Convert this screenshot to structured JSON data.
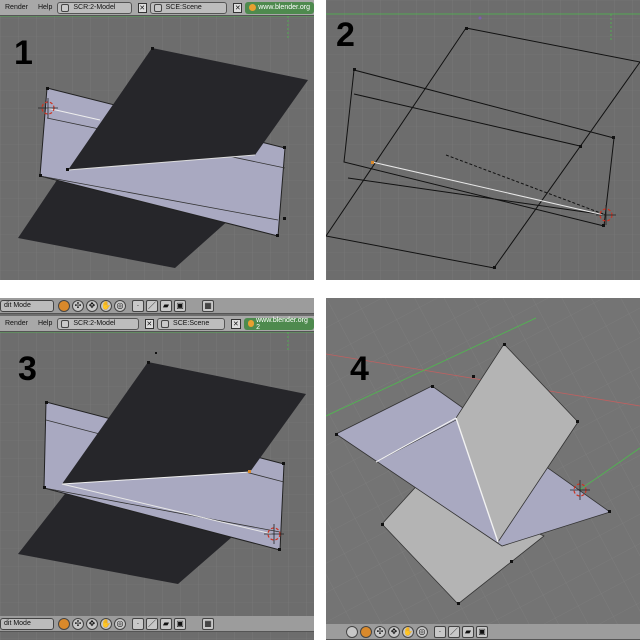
{
  "panels": [
    {
      "number": "1"
    },
    {
      "number": "2"
    },
    {
      "number": "3"
    },
    {
      "number": "4"
    }
  ],
  "header_top": {
    "menu": [
      "Render",
      "Help"
    ],
    "screen_label": "SCR:2-Model",
    "scene_label": "SCE:Scene",
    "url": "www.blender.org"
  },
  "header_p3": {
    "menu": [
      "Render",
      "Help"
    ],
    "screen_label": "SCR:2-Model",
    "scene_label": "SCE:Scene",
    "url": "www.blender.org 2"
  },
  "toolbar_p3_top": {
    "mode": "dit Mode"
  },
  "toolbar_p3_bottom": {
    "mode": "dit Mode"
  },
  "colors": {
    "viewport_bg": "#6d6d6d",
    "face_light": "#a9a9c1",
    "face_dark": "#2a2a2e",
    "grid": "#777777",
    "axis_green": "#4dbb4d",
    "axis_red": "#c06060",
    "cursor": "#cc3322"
  },
  "icons": {
    "close": "close-icon",
    "blender": "blender-logo-icon",
    "cursor": "3d-cursor-icon"
  }
}
